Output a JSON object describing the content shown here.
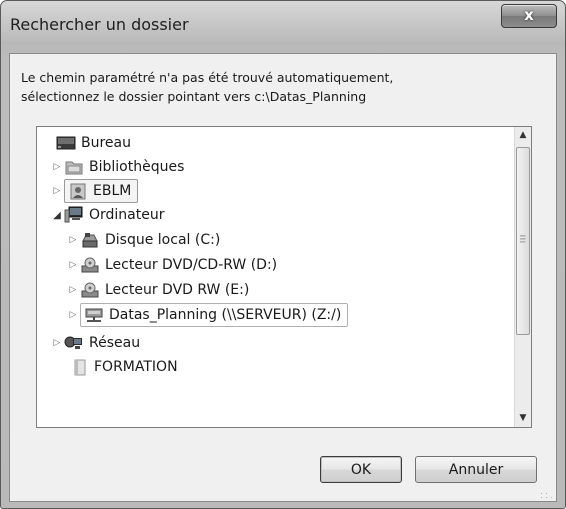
{
  "window": {
    "title": "Rechercher un dossier",
    "close_label": "x"
  },
  "message": {
    "line1": "Le chemin paramétré n'a pas été trouvé automatiquement,",
    "line2": "sélectionnez le dossier pointant vers c:\\Datas_Planning"
  },
  "tree": {
    "items": [
      {
        "label": "Bureau",
        "icon": "desktop-icon",
        "expander": ""
      },
      {
        "label": "Bibliothèques",
        "icon": "library-icon",
        "expander": "▷"
      },
      {
        "label": "EBLM",
        "icon": "user-folder-icon",
        "expander": "▷"
      },
      {
        "label": "Ordinateur",
        "icon": "computer-icon",
        "expander": "◢"
      },
      {
        "label": "Disque local (C:)",
        "icon": "hard-drive-icon",
        "expander": "▷"
      },
      {
        "label": "Lecteur DVD/CD-RW (D:)",
        "icon": "dvd-drive-icon",
        "expander": "▷"
      },
      {
        "label": "Lecteur DVD RW (E:)",
        "icon": "dvd-drive-icon",
        "expander": "▷"
      },
      {
        "label": "Datas_Planning (\\\\SERVEUR) (Z:/)",
        "icon": "network-drive-icon",
        "expander": "▷"
      },
      {
        "label": "Réseau",
        "icon": "network-icon",
        "expander": "▷"
      },
      {
        "label": "FORMATION",
        "icon": "folder-icon",
        "expander": ""
      }
    ]
  },
  "buttons": {
    "ok": "OK",
    "cancel": "Annuler"
  },
  "scrollbar": {
    "up": "▲",
    "down": "▼"
  }
}
